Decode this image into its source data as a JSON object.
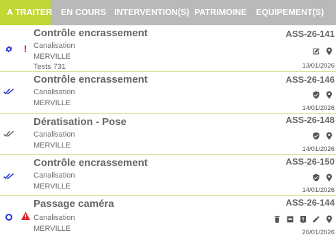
{
  "tabs": [
    {
      "label": "A TRAITER",
      "active": true
    },
    {
      "label": "EN COURS",
      "active": false
    },
    {
      "label": "INTERVENTION(S)",
      "active": false
    },
    {
      "label": "PATRIMOINE",
      "active": false
    },
    {
      "label": "EQUIPEMENT(S)",
      "active": false
    }
  ],
  "items": [
    {
      "title": "Contrôle encrassement",
      "type": "Canalisation",
      "city": "MERVILLE",
      "extra": "Tests 731",
      "ref": "ASS-26-141",
      "date": "13/01/2026",
      "status_icon": "gear-icon",
      "alert_icon": "exclamation-icon",
      "action_icons": [
        "edit-icon",
        "map-pin-icon"
      ]
    },
    {
      "title": "Contrôle encrassement",
      "type": "Canalisation",
      "city": "MERVILLE",
      "ref": "ASS-26-146",
      "date": "14/01/2026",
      "status_icon": "double-check-icon",
      "action_icons": [
        "shield-check-icon",
        "map-pin-icon"
      ]
    },
    {
      "title": "Dératisation - Pose",
      "type": "Canalisation",
      "city": "MERVILLE",
      "ref": "ASS-26-148",
      "date": "14/01/2026",
      "status_icon": "double-check-gray-icon",
      "action_icons": [
        "shield-check-icon",
        "map-pin-icon"
      ]
    },
    {
      "title": "Contrôle encrassement",
      "type": "Canalisation",
      "city": "MERVILLE",
      "ref": "ASS-26-150",
      "date": "14/01/2026",
      "status_icon": "double-check-icon",
      "action_icons": [
        "shield-check-icon",
        "map-pin-icon"
      ]
    },
    {
      "title": "Passage caméra",
      "type": "Canalisation",
      "city": "MERVILLE",
      "ref": "ASS-26-144",
      "date": "26/01/2026",
      "status_icon": "circle-dot-icon",
      "alert_icon": "warning-triangle-icon",
      "action_icons": [
        "trash-icon",
        "note-icon",
        "alert-box-icon",
        "pencil-icon",
        "map-pin-icon"
      ]
    }
  ],
  "colors": {
    "accent": "#c2d636",
    "tab_bar": "#b9b9b9",
    "status_blue": "#1f2fd0",
    "alert_red": "#e0202a"
  }
}
